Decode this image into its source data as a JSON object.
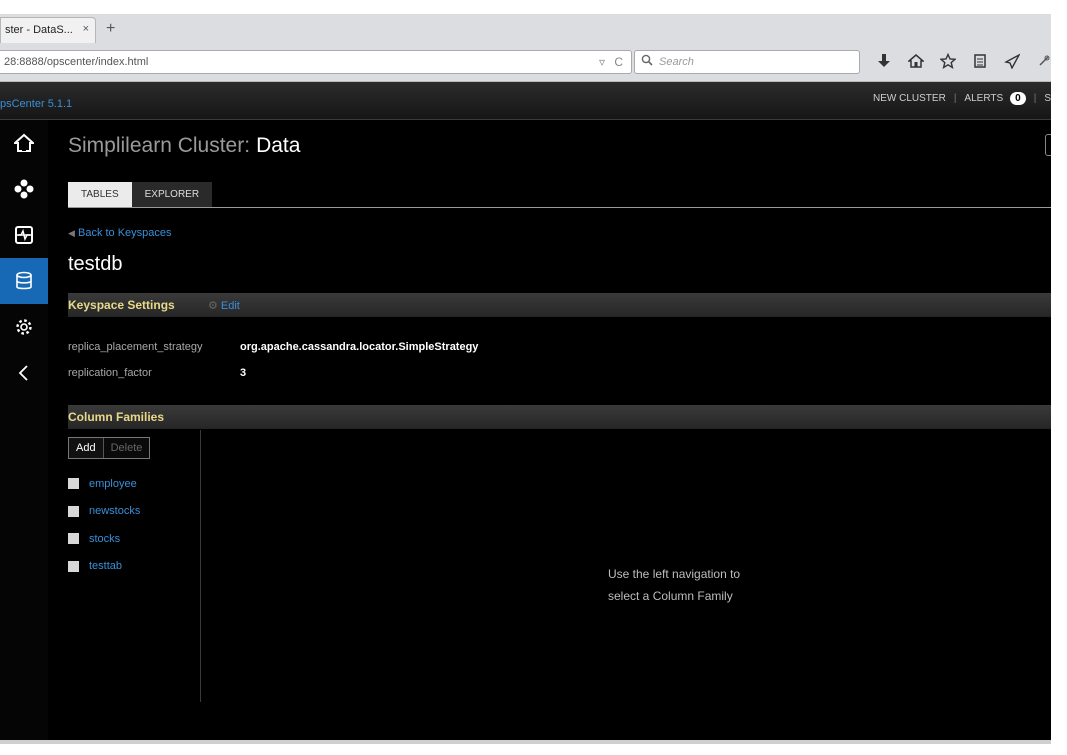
{
  "browser": {
    "tab_title": "ster - DataS...",
    "tab_close": "×",
    "new_tab": "+",
    "url": "28:8888/opscenter/index.html",
    "url_dropdown": "▿",
    "reload": "C",
    "search_placeholder": "Search",
    "toolbar_icons": [
      "download-icon",
      "home-icon",
      "star-icon",
      "reading-list-icon",
      "send-icon",
      "extension-icon"
    ]
  },
  "app": {
    "brand": "psCenter 5.1.1",
    "topnav": {
      "new_cluster": "NEW CLUSTER",
      "alerts": "ALERTS",
      "alerts_count": "0",
      "cut_item": "S"
    },
    "sidebar": {
      "items": [
        {
          "icon": "home-icon"
        },
        {
          "icon": "cluster-nodes-icon"
        },
        {
          "icon": "dashboard-icon"
        },
        {
          "icon": "database-icon",
          "active": true
        },
        {
          "icon": "settings-gear-icon"
        },
        {
          "icon": "collapse-chevron-icon"
        }
      ],
      "active_color": "#1769b5"
    },
    "page": {
      "title_prefix": "Simplilearn Cluster:",
      "title_main": "Data"
    },
    "tabs": [
      {
        "label": "TABLES",
        "active": true
      },
      {
        "label": "EXPLORER",
        "active": false
      }
    ],
    "back_link": "Back to Keyspaces",
    "keyspace_name": "testdb",
    "keyspace_settings": {
      "title": "Keyspace Settings",
      "edit_label": "Edit",
      "properties": [
        {
          "key": "replica_placement_strategy",
          "value": "org.apache.cassandra.locator.SimpleStrategy"
        },
        {
          "key": "replication_factor",
          "value": "3"
        }
      ]
    },
    "column_families": {
      "title": "Column Families",
      "add_label": "Add",
      "delete_label": "Delete",
      "items": [
        "employee",
        "newstocks",
        "stocks",
        "testtab"
      ]
    },
    "hint": {
      "line1": "Use the left navigation to",
      "line2": "select a Column Family"
    },
    "colors": {
      "link": "#3a8fd8",
      "section_title": "#e8d98a",
      "background": "#000000"
    }
  }
}
